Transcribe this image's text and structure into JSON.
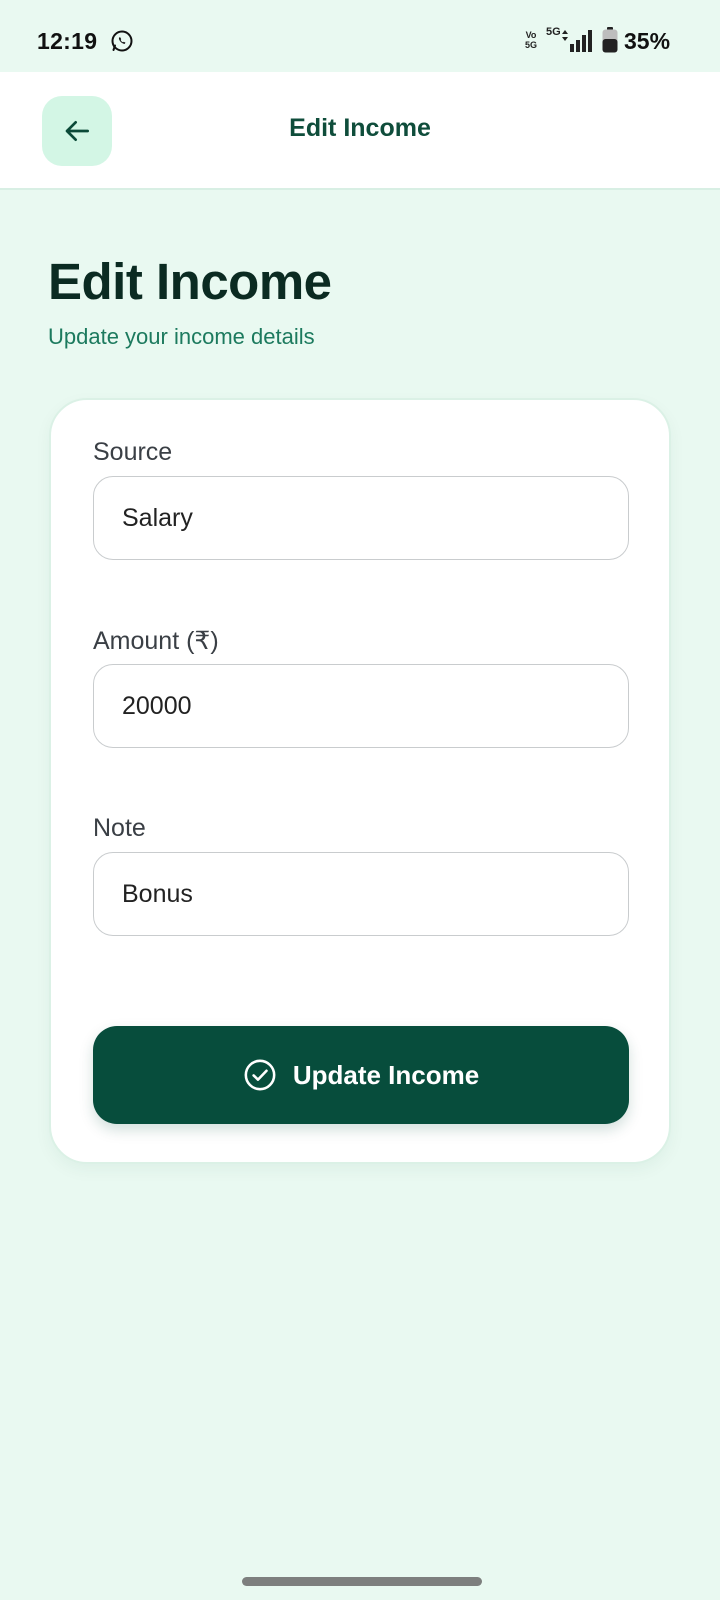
{
  "status_bar": {
    "time": "12:19",
    "volte": "Vo 5G",
    "network": "5G",
    "battery": "35%",
    "icons": [
      "whatsapp-icon",
      "volte-icon",
      "signal-icon",
      "battery-icon"
    ]
  },
  "app_bar": {
    "title": "Edit Income",
    "back_icon": "arrow-left-icon"
  },
  "page": {
    "heading": "Edit Income",
    "subtitle": "Update your income details"
  },
  "form": {
    "source": {
      "label": "Source",
      "value": "Salary"
    },
    "amount": {
      "label": "Amount (₹)",
      "value": "20000"
    },
    "note": {
      "label": "Note",
      "value": "Bonus"
    },
    "submit": {
      "label": "Update Income",
      "icon": "check-circle-icon"
    }
  },
  "colors": {
    "background": "#e9f9f1",
    "primary": "#074d3c",
    "accent_soft": "#d3f6e5",
    "subtitle": "#1c7a5e"
  }
}
